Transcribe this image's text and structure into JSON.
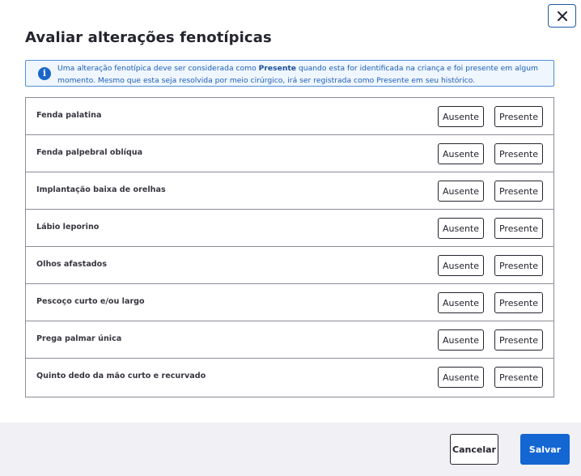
{
  "modal": {
    "title": "Avaliar alterações fenotípicas",
    "close_icon": "close-icon"
  },
  "info": {
    "icon": "info-icon",
    "text_before": "Uma alteração fenotípica deve ser considerada como ",
    "highlight_1": "Presente",
    "text_middle": " quando esta for identificada na criança e foi presente em algum momento. Mesmo que esta seja resolvida por meio cirúrgico, irá ser registrada como ",
    "highlight_2": "Presente",
    "text_after": " em seu histórico."
  },
  "options": {
    "absent_label": "Ausente",
    "present_label": "Presente"
  },
  "rows": [
    {
      "label": "Fenda palatina"
    },
    {
      "label": "Fenda palpebral oblíqua"
    },
    {
      "label": "Implantação baixa de orelhas"
    },
    {
      "label": "Lábio leporino"
    },
    {
      "label": "Olhos afastados"
    },
    {
      "label": "Pescoço curto e/ou largo"
    },
    {
      "label": "Prega palmar única"
    },
    {
      "label": "Quinto dedo da mão curto e recurvado"
    }
  ],
  "footer": {
    "cancel_label": "Cancelar",
    "save_label": "Salvar"
  },
  "colors": {
    "primary": "#1466d2",
    "info_border": "#4f8fd8",
    "info_bg": "#f0f6fe",
    "footer_bg": "#f0f0f5"
  }
}
